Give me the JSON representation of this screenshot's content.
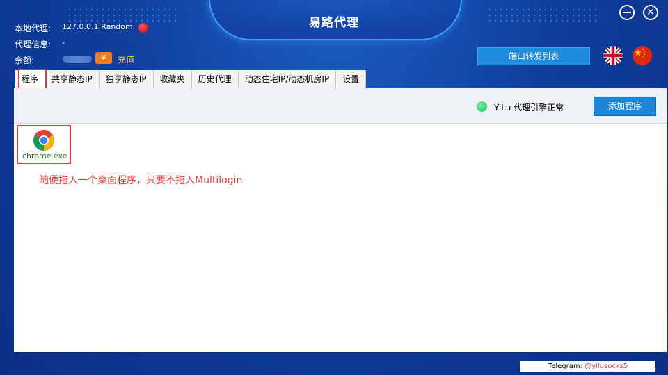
{
  "app": {
    "title": "易路代理"
  },
  "window": {
    "minimize_label": "—",
    "close_label": "✕"
  },
  "info": {
    "local_proxy_label": "本地代理:",
    "local_proxy_value": "127.0.0.1:Random",
    "proxy_info_label": "代理信息:",
    "proxy_info_value": "-",
    "balance_label": "余额:",
    "currency_symbol": "¥",
    "recharge_label": "充值"
  },
  "header": {
    "port_forward_label": "端口转发列表"
  },
  "tabs": [
    {
      "label": "程序"
    },
    {
      "label": "共享静态IP"
    },
    {
      "label": "独享静态IP"
    },
    {
      "label": "收藏夹"
    },
    {
      "label": "历史代理"
    },
    {
      "label": "动态住宅IP/动态机房IP"
    },
    {
      "label": "设置"
    }
  ],
  "toolbar": {
    "engine_status": "YiLu 代理引擎正常",
    "add_program_label": "添加程序"
  },
  "programs": [
    {
      "name": "chrome.exe",
      "icon": "chrome-icon"
    }
  ],
  "hint": "随便拖入一个桌面程序，只要不拖入Multilogin",
  "footer": {
    "telegram_label": "Telegram:",
    "telegram_handle": "@yilusocks5"
  },
  "colors": {
    "accent": "#1f86d6",
    "highlight": "#e53b3b",
    "status_ok": "#1bbf62",
    "status_off": "#d00000"
  }
}
